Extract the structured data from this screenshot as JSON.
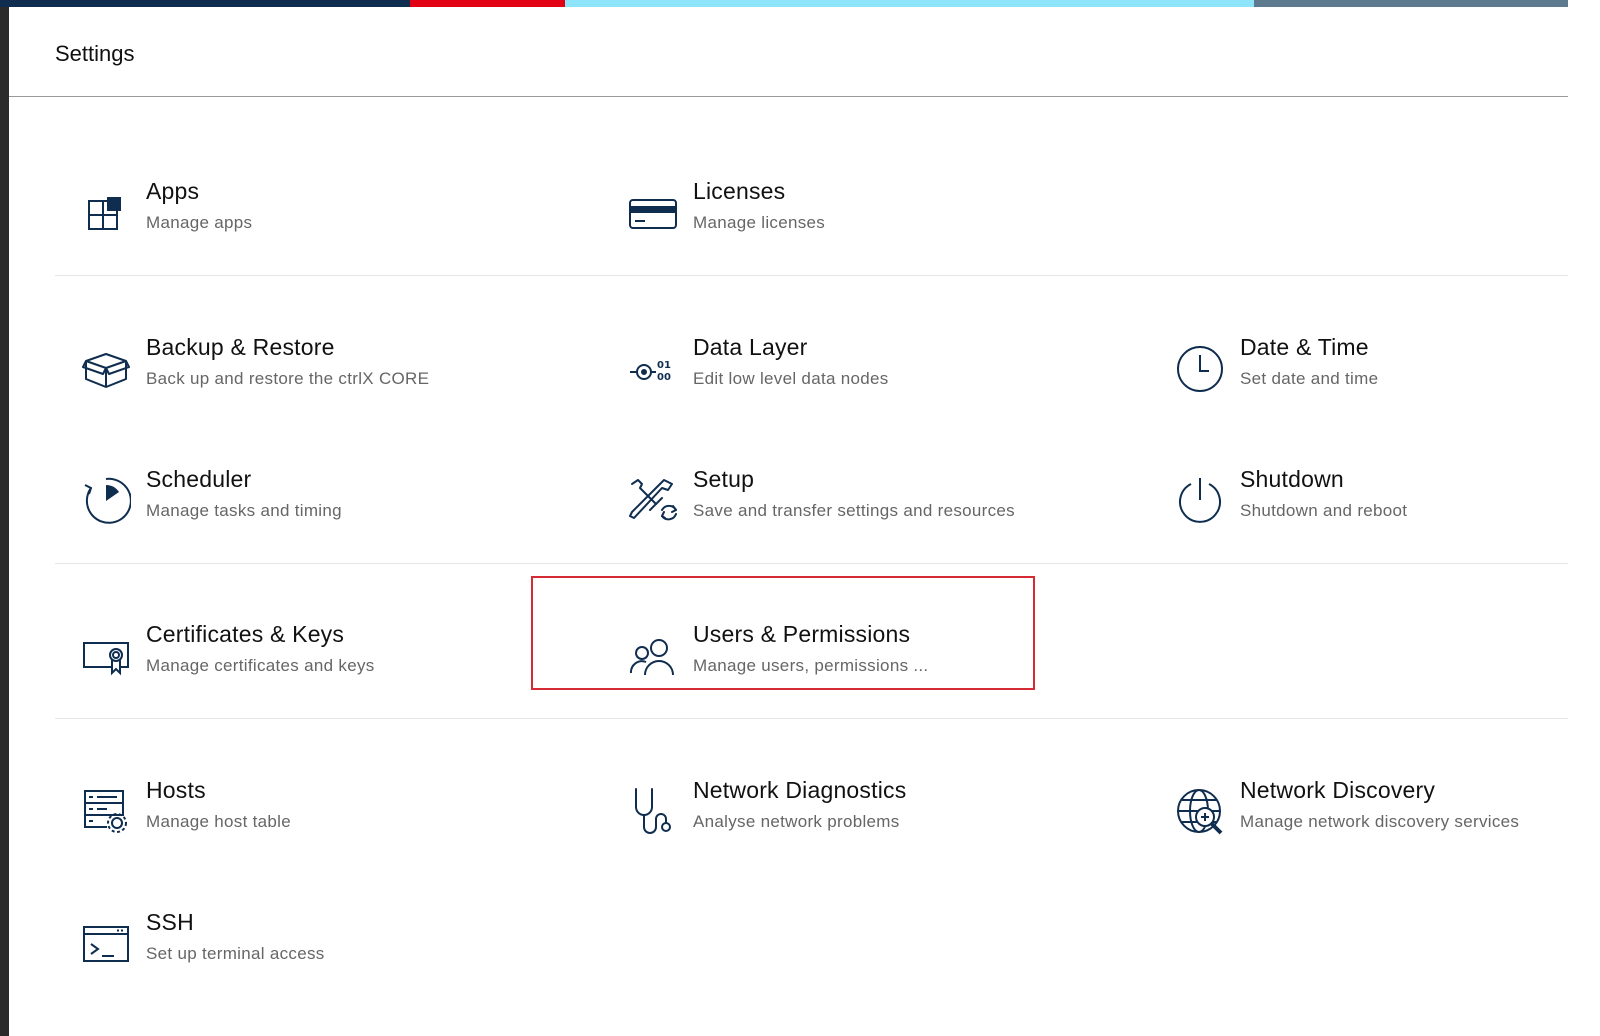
{
  "colors": {
    "accent_navy": "#0f2d4f",
    "accent_red": "#e20015",
    "accent_cyan": "#8ee4fb",
    "accent_slate": "#5d7a8f",
    "highlight": "#d62b35",
    "icon": "#0f2d4f"
  },
  "header": {
    "title": "Settings"
  },
  "tiles": [
    {
      "title": "Apps",
      "subtitle": "Manage apps",
      "icon": "apps-icon"
    },
    {
      "title": "Licenses",
      "subtitle": "Manage licenses",
      "icon": "license-card-icon"
    },
    {
      "title": "Backup & Restore",
      "subtitle": "Back up and restore the ctrlX CORE",
      "icon": "box-icon"
    },
    {
      "title": "Data Layer",
      "subtitle": "Edit low level data nodes",
      "icon": "data-layer-icon"
    },
    {
      "title": "Date & Time",
      "subtitle": "Set date and time",
      "icon": "clock-icon"
    },
    {
      "title": "Scheduler",
      "subtitle": "Manage tasks and timing",
      "icon": "scheduler-icon"
    },
    {
      "title": "Setup",
      "subtitle": "Save and transfer settings and resources",
      "icon": "tools-icon"
    },
    {
      "title": "Shutdown",
      "subtitle": "Shutdown and reboot",
      "icon": "power-icon"
    },
    {
      "title": "Certificates & Keys",
      "subtitle": "Manage certificates and keys",
      "icon": "certificate-icon"
    },
    {
      "title": "Users & Permissions",
      "subtitle": "Manage users, permissions ...",
      "icon": "users-icon"
    },
    {
      "title": "Hosts",
      "subtitle": "Manage host table",
      "icon": "hosts-icon"
    },
    {
      "title": "Network Diagnostics",
      "subtitle": "Analyse network problems",
      "icon": "stethoscope-icon"
    },
    {
      "title": "Network Discovery",
      "subtitle": "Manage network discovery services",
      "icon": "network-discovery-icon"
    },
    {
      "title": "SSH",
      "subtitle": "Set up terminal access",
      "icon": "terminal-icon"
    }
  ]
}
